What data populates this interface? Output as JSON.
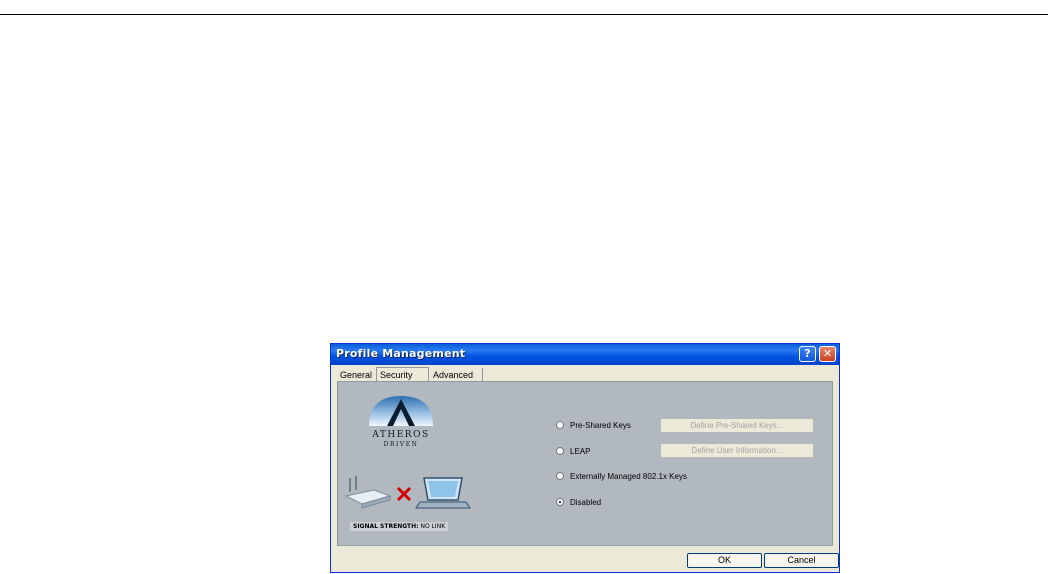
{
  "window": {
    "title": "Profile Management",
    "help_glyph": "?",
    "close_glyph": "✕"
  },
  "tabs": [
    {
      "label": "General"
    },
    {
      "label": "Security"
    },
    {
      "label": "Advanced"
    }
  ],
  "branding": {
    "line1": "ATHEROS",
    "line2": "DRIVEN"
  },
  "signal": {
    "label": "SIGNAL STRENGTH:",
    "value": "NO LINK"
  },
  "security_options": [
    {
      "label": "Pre-Shared Keys",
      "selected": false,
      "button": "Define Pre-Shared Keys..."
    },
    {
      "label": "LEAP",
      "selected": false,
      "button": "Define User Information..."
    },
    {
      "label": "Externally Managed 802.1x Keys",
      "selected": false
    },
    {
      "label": "Disabled",
      "selected": true
    }
  ],
  "buttons": {
    "ok": "OK",
    "cancel": "Cancel"
  },
  "colors": {
    "titlebar": "#0a5fd8",
    "panel": "#b2b8c0",
    "dialog": "#ece9d8",
    "x_mark": "#d40000"
  }
}
